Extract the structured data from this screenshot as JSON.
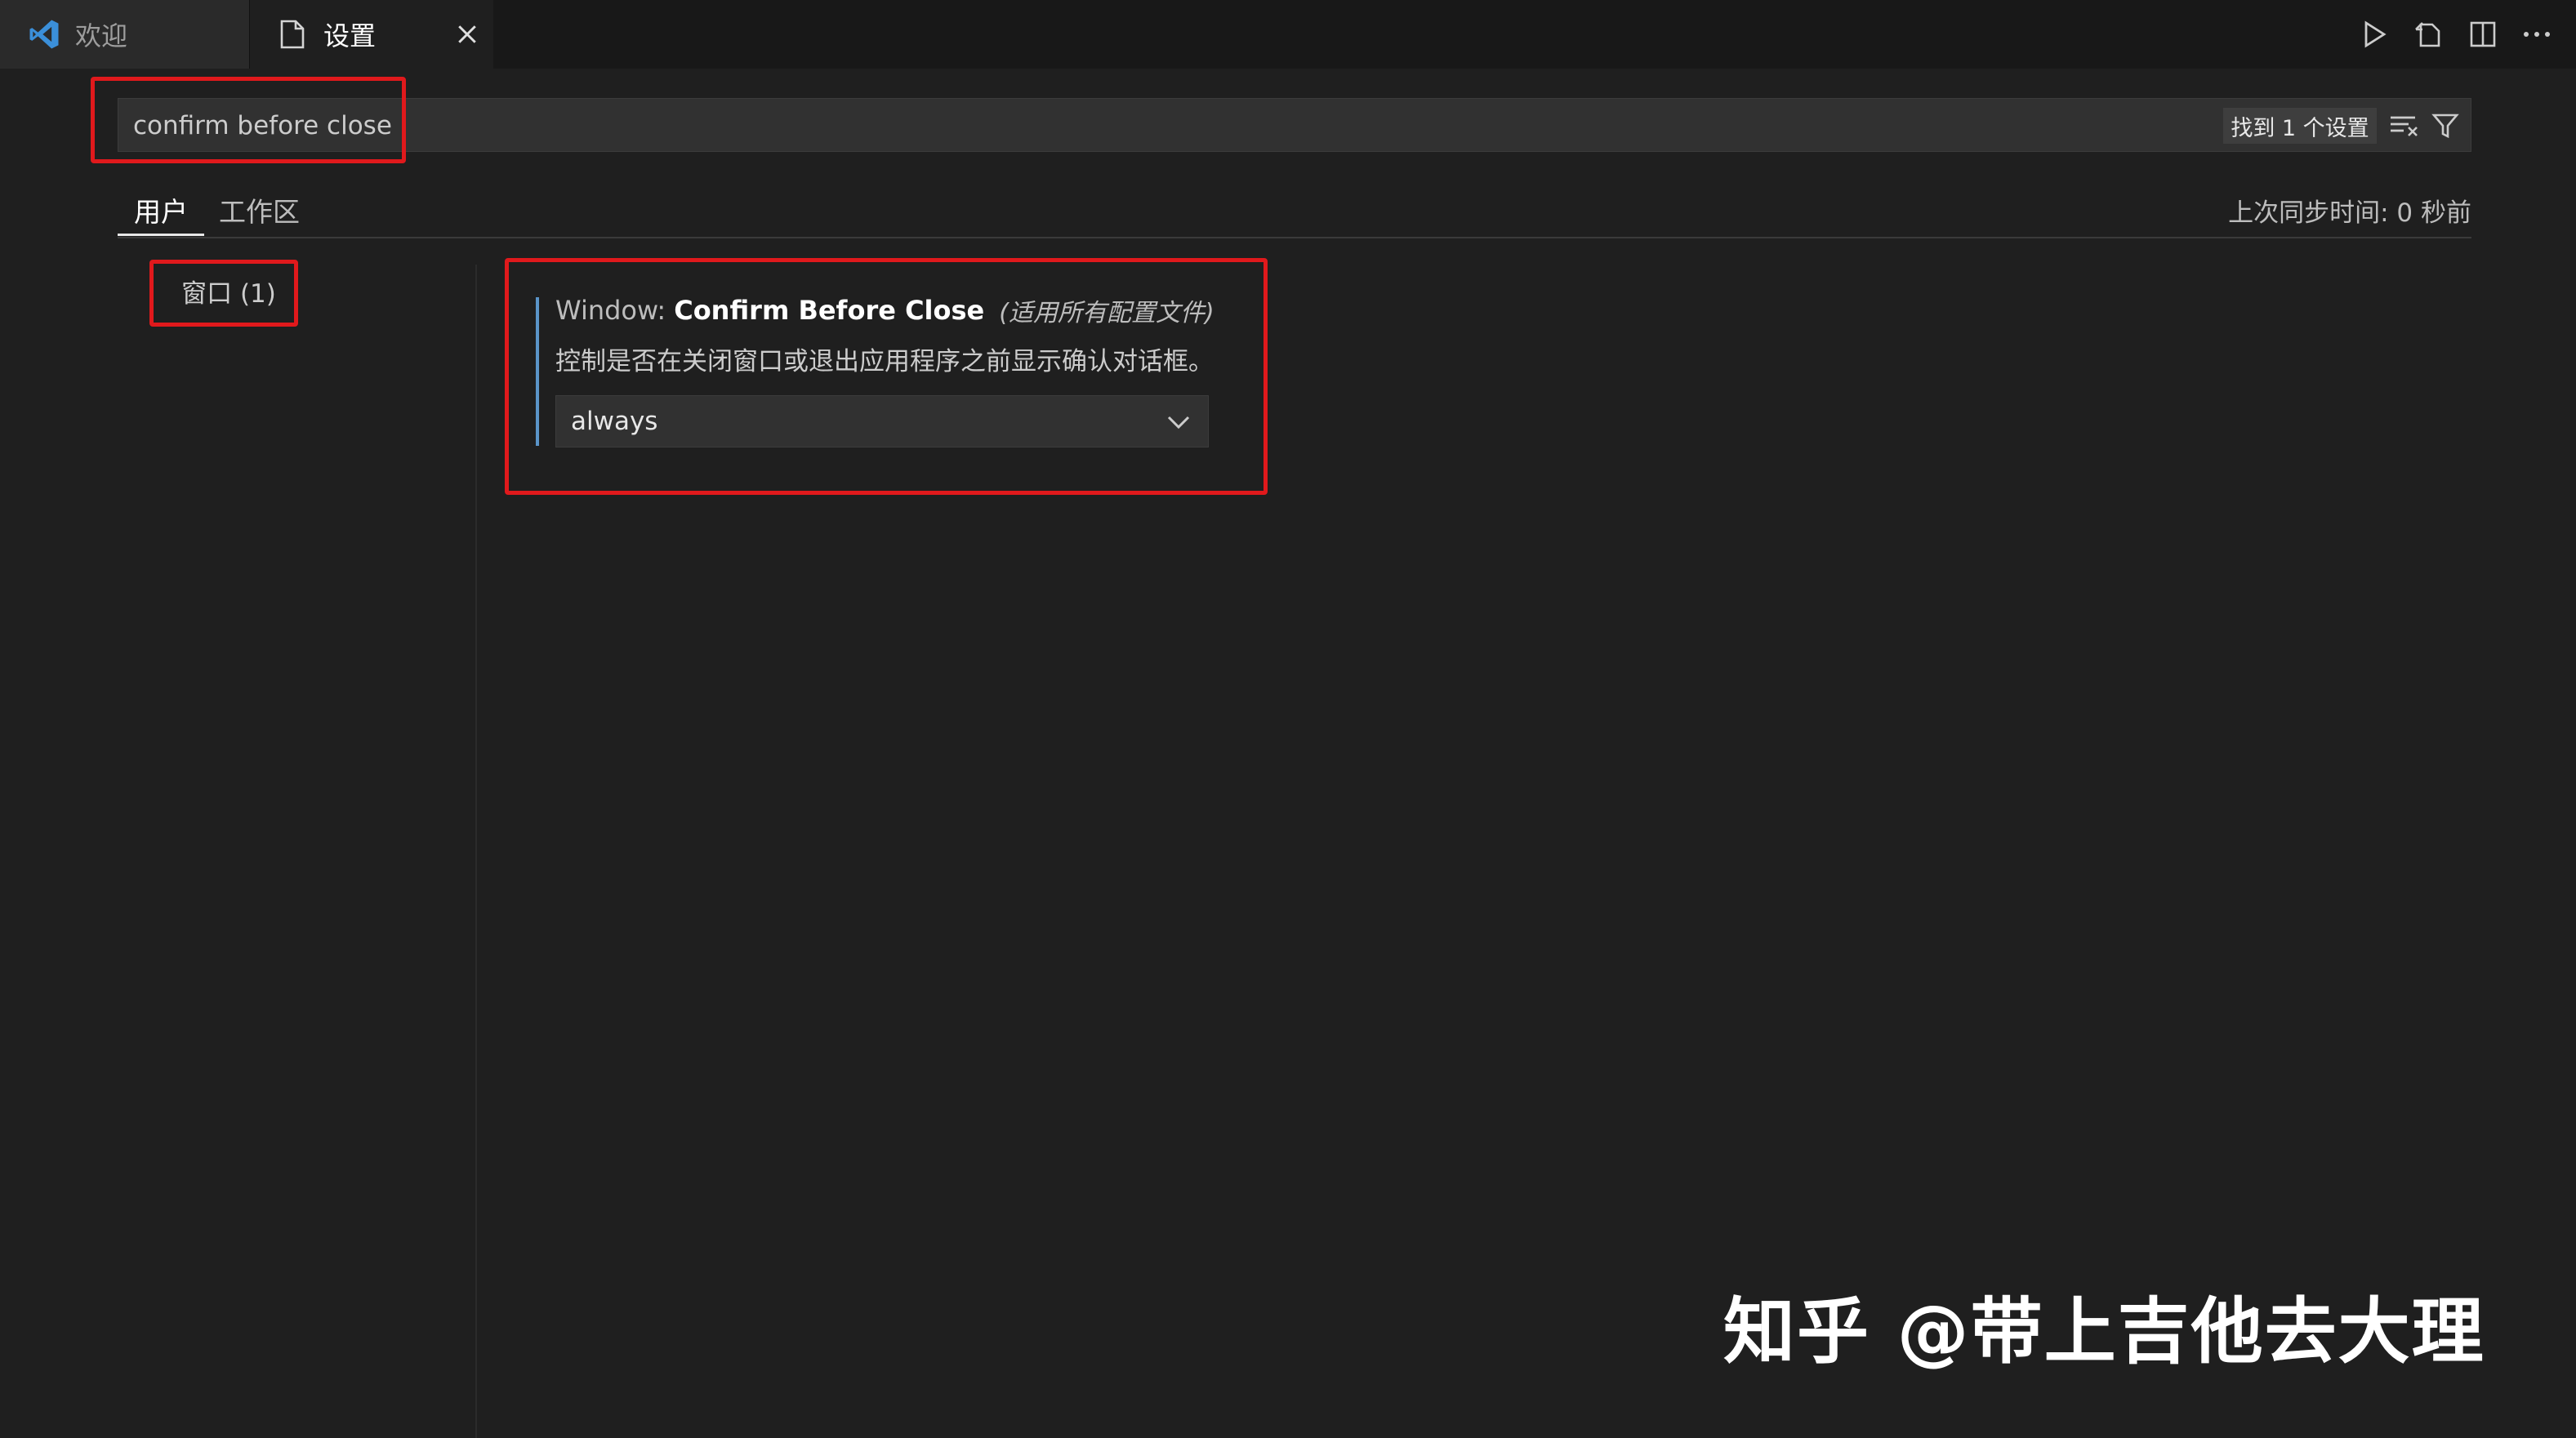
{
  "tabs": {
    "welcome": {
      "label": "欢迎",
      "icon": "vscode-logo-icon"
    },
    "settings": {
      "label": "设置",
      "icon": "file-icon",
      "close_icon": "close-icon"
    }
  },
  "editor_actions": [
    "run-icon",
    "open-settings-json-icon",
    "split-editor-icon",
    "more-actions-icon"
  ],
  "search": {
    "value": "confirm before close",
    "result_count": "找到 1 个设置",
    "clear_icon": "clear-filter-icon",
    "filter_icon": "filter-icon"
  },
  "scope_tabs": {
    "user": "用户",
    "workspace": "工作区",
    "active": "user"
  },
  "sync_status": "上次同步时间: 0 秒前",
  "toc": {
    "items": [
      {
        "label": "窗口 (1)"
      }
    ]
  },
  "setting": {
    "category": "Window:",
    "name": "Confirm Before Close",
    "scope": "(适用所有配置文件)",
    "description": "控制是否在关闭窗口或退出应用程序之前显示确认对话框。",
    "value": "always"
  },
  "watermark": "知乎 @带上吉他去大理",
  "colors": {
    "background": "#1f1f1f",
    "tabbar": "#181818",
    "input": "#313131",
    "accent_bar": "#5a94c8",
    "highlight": "#e0191c"
  }
}
